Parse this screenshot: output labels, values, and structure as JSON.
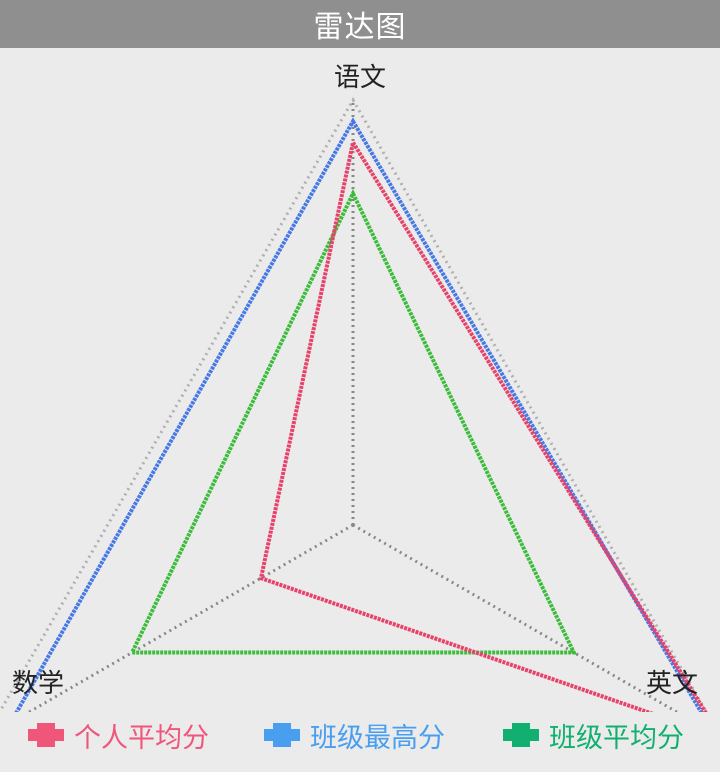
{
  "header": {
    "title": "雷达图"
  },
  "chart_data": {
    "type": "radar",
    "axes": [
      "语文",
      "英文",
      "数学"
    ],
    "max": 100,
    "series": [
      {
        "name": "个人平均分",
        "color": "#e8416a",
        "legend_color": "#f0557a",
        "values": [
          90,
          100,
          25
        ]
      },
      {
        "name": "班级最高分",
        "color": "#4678e6",
        "legend_color": "#4a9ef0",
        "values": [
          95,
          98,
          93
        ]
      },
      {
        "name": "班级平均分",
        "color": "#3bbd3b",
        "legend_color": "#12b070",
        "values": [
          78,
          60,
          60
        ]
      }
    ]
  }
}
